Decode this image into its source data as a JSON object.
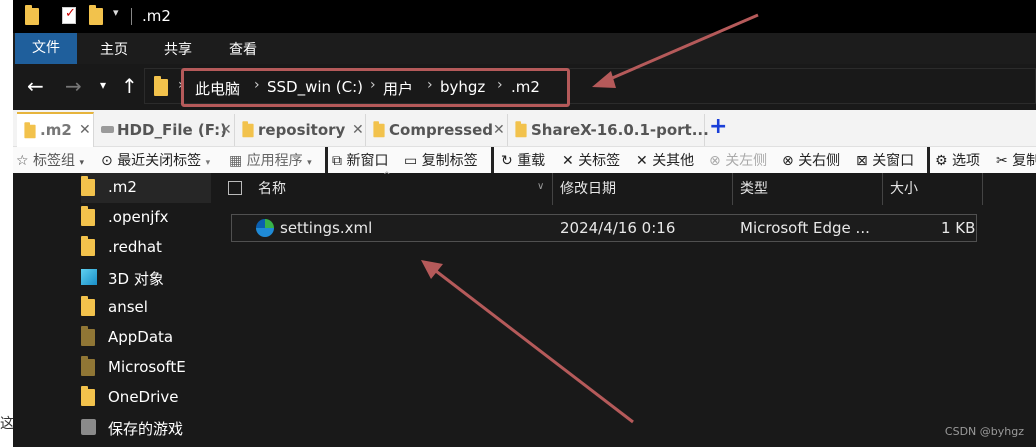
{
  "window": {
    "title": ".m2"
  },
  "ribbon": {
    "tabs": [
      "文件",
      "主页",
      "共享",
      "查看"
    ]
  },
  "address": {
    "crumbs": [
      "此电脑",
      "SSD_win (C:)",
      "用户",
      "byhgz",
      ".m2"
    ]
  },
  "tabs": [
    {
      "label": ".m2"
    },
    {
      "label": "HDD_File (F:)"
    },
    {
      "label": "repository"
    },
    {
      "label": "Compressed"
    },
    {
      "label": "ShareX-16.0.1-port..."
    }
  ],
  "tab_close": "✕",
  "tab_add": "+",
  "toolbar": {
    "items": [
      "标签组",
      "最近关闭标签",
      "应用程序",
      "新窗口",
      "复制标签",
      "重载",
      "关标签",
      "关其他",
      "关左侧",
      "关右侧",
      "关窗口",
      "选项",
      "复制"
    ]
  },
  "navpane": {
    "items": [
      ".m2",
      ".openjfx",
      ".redhat",
      "3D 对象",
      "ansel",
      "AppData",
      "MicrosoftE",
      "OneDrive",
      "保存的游戏"
    ]
  },
  "columns": {
    "name": "名称",
    "date": "修改日期",
    "type": "类型",
    "size": "大小"
  },
  "files": [
    {
      "name": "settings.xml",
      "date": "2024/4/16 0:16",
      "type": "Microsoft Edge ...",
      "size": "1 KB"
    }
  ],
  "left_edge_char": "这",
  "watermark": "CSDN @byhgz",
  "colors": {
    "arrow": "#b55a5a",
    "highlight_box": "#b55a5a",
    "file_tab": "#1f5f9c"
  }
}
